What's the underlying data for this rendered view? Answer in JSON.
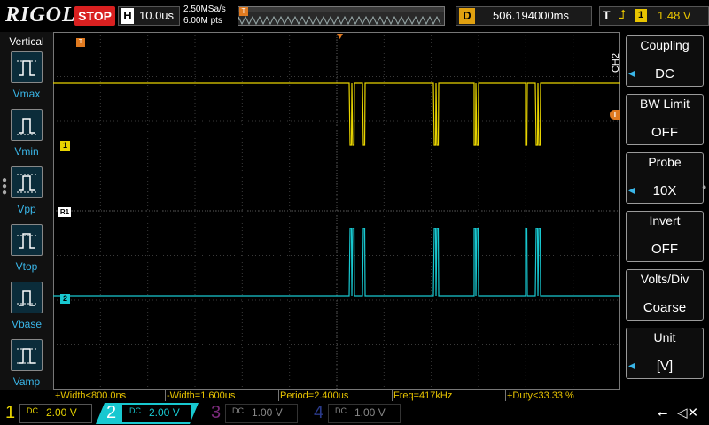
{
  "brand": "RIGOL",
  "run_state": "STOP",
  "timebase": {
    "label": "H",
    "value": "10.0us"
  },
  "acquisition": {
    "sample_rate": "2.50MSa/s",
    "memory_depth": "6.00M pts"
  },
  "trigger_position": {
    "label": "D",
    "value": "506.194000ms"
  },
  "trigger": {
    "label": "T",
    "edge_icon": "rising-edge-icon",
    "source": "1",
    "level": "1.48 V"
  },
  "left_panel": {
    "title": "Vertical",
    "items": [
      {
        "label": "Vmax",
        "icon": "vmax-icon"
      },
      {
        "label": "Vmin",
        "icon": "vmin-icon"
      },
      {
        "label": "Vpp",
        "icon": "vpp-icon"
      },
      {
        "label": "Vtop",
        "icon": "vtop-icon"
      },
      {
        "label": "Vbase",
        "icon": "vbase-icon"
      },
      {
        "label": "Vamp",
        "icon": "vamp-icon"
      }
    ]
  },
  "right_panel": {
    "channel_tag": "CH2",
    "items": [
      {
        "title": "Coupling",
        "value": "DC",
        "has_arrow": true
      },
      {
        "title": "BW Limit",
        "value": "OFF",
        "has_arrow": false
      },
      {
        "title": "Probe",
        "value": "10X",
        "has_arrow": true
      },
      {
        "title": "Invert",
        "value": "OFF",
        "has_arrow": false
      },
      {
        "title": "Volts/Div",
        "value": "Coarse",
        "has_arrow": false
      },
      {
        "title": "Unit",
        "value": "[V]",
        "has_arrow": true
      }
    ]
  },
  "markers": {
    "ch1": "1",
    "ch2": "2",
    "ref": "R1",
    "trig_top": "T",
    "trig_level": "T"
  },
  "measurements": [
    "+Width<800.0ns",
    "-Width=1.600us",
    "Period=2.400us",
    "Freq=417kHz",
    "+Duty<33.33 %"
  ],
  "channels": [
    {
      "num": "1",
      "coupling": "DC",
      "scale": "2.00 V",
      "active": true
    },
    {
      "num": "2",
      "coupling": "DC",
      "scale": "2.00 V",
      "active": true
    },
    {
      "num": "3",
      "coupling": "DC",
      "scale": "1.00 V",
      "active": false
    },
    {
      "num": "4",
      "coupling": "DC",
      "scale": "1.00 V",
      "active": false
    }
  ],
  "colors": {
    "ch1": "#e8d400",
    "ch2": "#18c8d0",
    "ch3": "#c030c0",
    "ch4": "#3060e0",
    "stop": "#d92020",
    "trigger": "#e07a20",
    "accent": "#3ab6e8"
  },
  "icons": {
    "usb": "usb-icon",
    "speaker": "speaker-muted-icon"
  }
}
